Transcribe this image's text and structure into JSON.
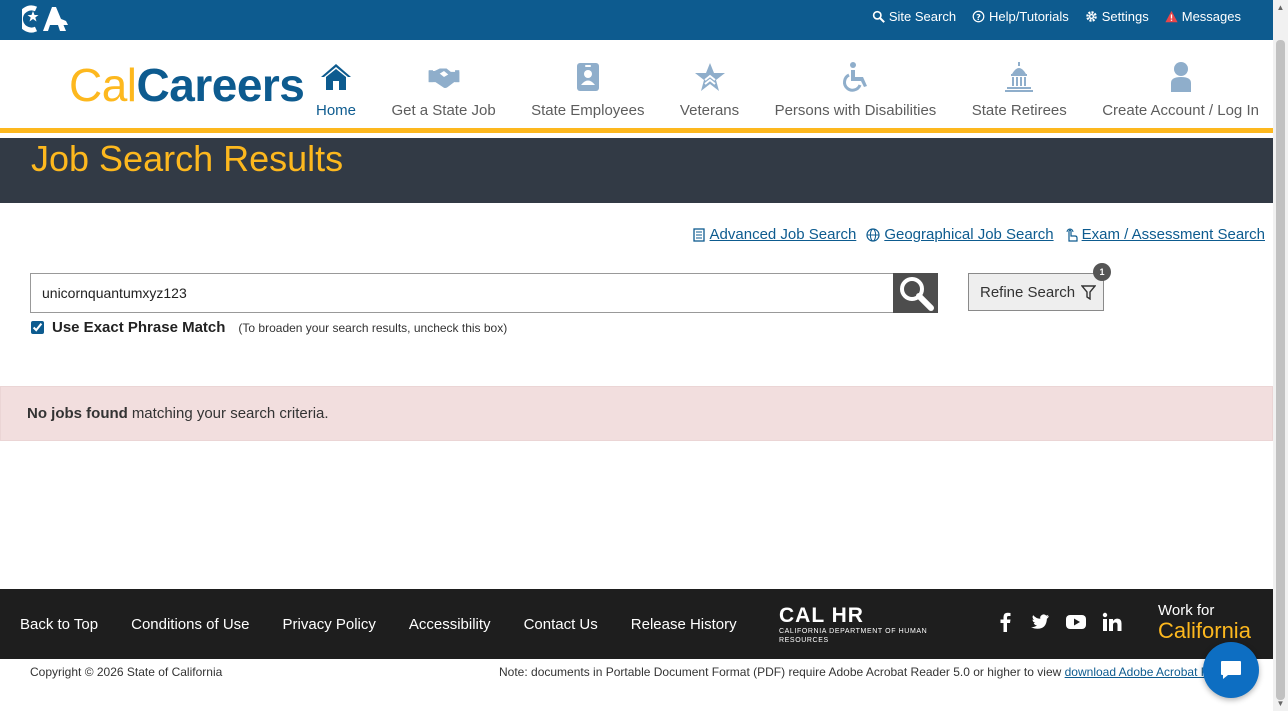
{
  "utility_bar": {
    "links": [
      {
        "label": "Site Search",
        "icon": "search-icon"
      },
      {
        "label": "Help/Tutorials",
        "icon": "question-circle-icon"
      },
      {
        "label": "Settings",
        "icon": "gear-icon"
      },
      {
        "label": "Messages",
        "icon": "warning-icon"
      }
    ]
  },
  "brand": {
    "cal": "Cal",
    "careers": "Careers"
  },
  "nav": {
    "items": [
      {
        "label": "Home",
        "icon": "home-icon"
      },
      {
        "label": "Get a State Job",
        "icon": "handshake-icon"
      },
      {
        "label": "State Employees",
        "icon": "id-badge-icon"
      },
      {
        "label": "Veterans",
        "icon": "star-icon"
      },
      {
        "label": "Persons with Disabilities",
        "icon": "wheelchair-icon"
      },
      {
        "label": "State Retirees",
        "icon": "capitol-icon"
      },
      {
        "label": "Create Account / Log In",
        "icon": "user-icon"
      }
    ]
  },
  "page_title": "Job Search Results",
  "search_links": {
    "advanced": "Advanced Job Search",
    "geographical": "Geographical Job Search",
    "exam": "Exam / Assessment Search"
  },
  "search": {
    "value": "unicornquantumxyz123",
    "exact_label": "Use Exact Phrase Match",
    "exact_hint": "(To broaden your search results, uncheck this box)",
    "refine_label": "Refine Search",
    "refine_badge": "1"
  },
  "alert": {
    "bold": "No jobs found",
    "rest": "matching your search criteria."
  },
  "footer": {
    "links": [
      "Back to Top",
      "Conditions of Use",
      "Privacy Policy",
      "Accessibility",
      "Contact Us",
      "Release History"
    ],
    "calhr_big": "CAL HR",
    "calhr_small": "CALIFORNIA DEPARTMENT OF HUMAN RESOURCES",
    "wfc_line1": "Work for",
    "wfc_line2": "California"
  },
  "copyright": "Copyright © 2026 State of California",
  "pdf_note": {
    "text": "Note: documents in Portable Document Format (PDF) require Adobe Acrobat Reader 5.0 or higher to view ",
    "link": "download Adobe Acrobat Reader"
  },
  "colors": {
    "brand_blue": "#0d5b8f",
    "gold": "#fdb81e",
    "dark": "#323a45",
    "alert_bg": "#f2dede"
  }
}
